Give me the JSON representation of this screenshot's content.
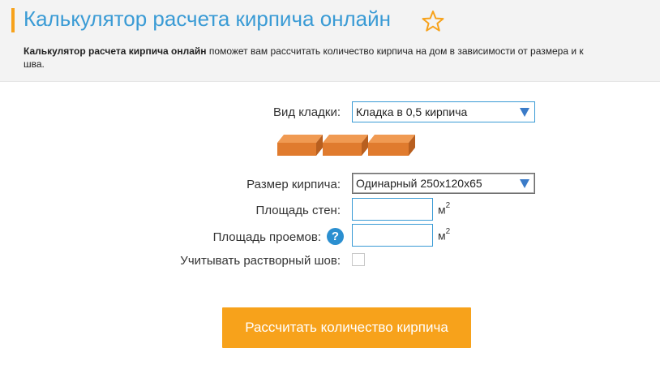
{
  "header": {
    "title": "Калькулятор расчета кирпича онлайн",
    "desc_bold": "Калькулятор расчета кирпича онлайн",
    "desc_rest": " поможет вам рассчитать количество кирпича на дом в зависимости от размера и к",
    "desc_line2": "шва."
  },
  "form": {
    "masonry_label": "Вид кладки:",
    "masonry_value": "Кладка в 0,5 кирпича",
    "brick_size_label": "Размер кирпича:",
    "brick_size_value": "Одинарный 250x120x65",
    "wall_area_label": "Площадь стен:",
    "wall_area_value": "",
    "wall_area_unit": "м",
    "wall_area_unit_sup": "2",
    "openings_label": "Площадь проемов:",
    "openings_value": "",
    "openings_unit": "м",
    "openings_unit_sup": "2",
    "help_glyph": "?",
    "mortar_label": "Учитывать растворный шов:",
    "mortar_checked": false
  },
  "actions": {
    "calculate_label": "Рассчитать количество кирпича"
  },
  "colors": {
    "accent": "#f7a21b",
    "title": "#3a9bd5",
    "brick": "#e07b2e"
  },
  "icons": {
    "favorite": "star-icon",
    "help": "help-icon",
    "dropdown": "chevron-down-icon"
  }
}
